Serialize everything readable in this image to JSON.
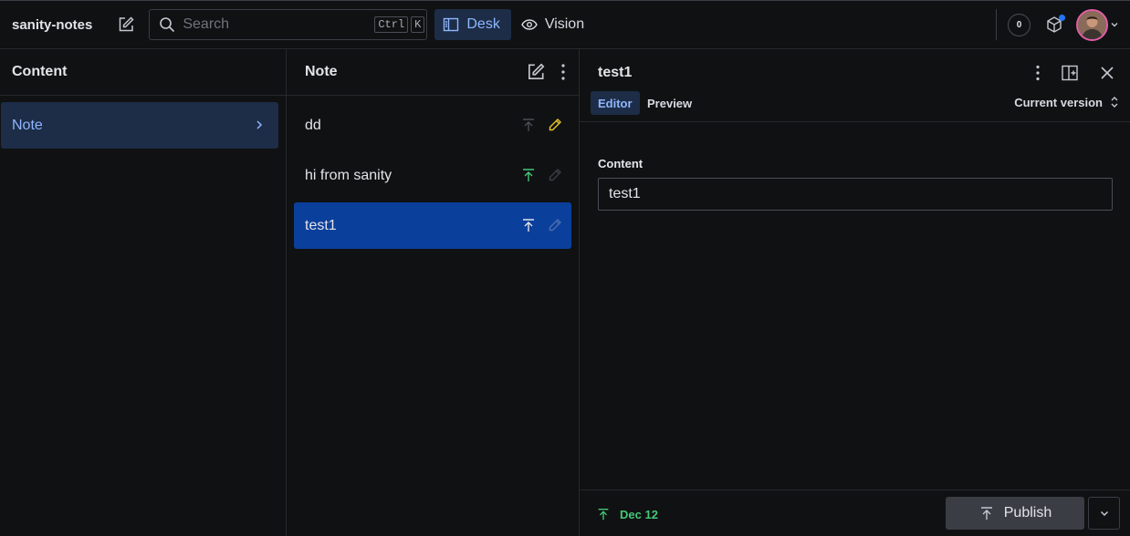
{
  "topbar": {
    "brand": "sanity-notes",
    "search_placeholder": "Search",
    "shortcut_keys": [
      "Ctrl",
      "K"
    ],
    "tools": [
      {
        "label": "Desk",
        "icon": "desk-icon",
        "active": true
      },
      {
        "label": "Vision",
        "icon": "eye-icon",
        "active": false
      }
    ],
    "notifications_count": "0"
  },
  "content_pane": {
    "title": "Content",
    "items": [
      {
        "label": "Note"
      }
    ]
  },
  "note_pane": {
    "title": "Note",
    "documents": [
      {
        "title": "dd"
      },
      {
        "title": "hi from sanity"
      },
      {
        "title": "test1"
      }
    ]
  },
  "document_pane": {
    "title": "test1",
    "tabs": [
      {
        "label": "Editor"
      },
      {
        "label": "Preview"
      }
    ],
    "version": "Current version",
    "field": {
      "label": "Content",
      "value": "test1"
    },
    "footer": {
      "status_date": "Dec 12",
      "publish_label": "Publish"
    }
  },
  "colors": {
    "accent": "#8fb6ff",
    "selected_bg": "#0b3f9c",
    "published": "#43c779",
    "edited": "#e8c22a"
  }
}
